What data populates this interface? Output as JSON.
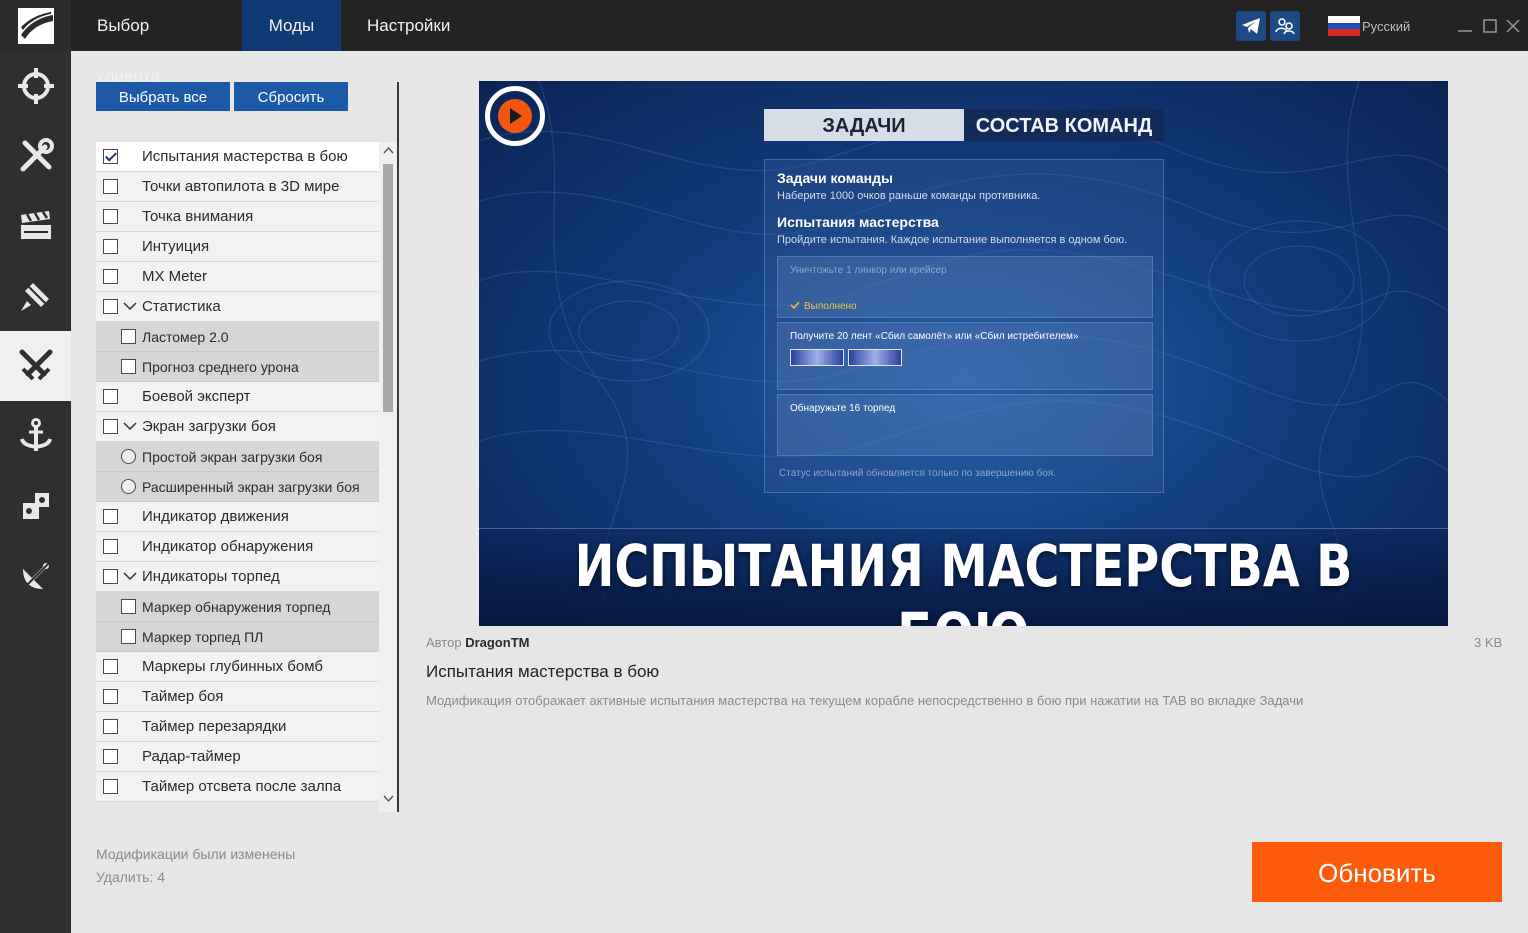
{
  "header": {
    "tabs": [
      {
        "label": "Выбор клиента",
        "active": false
      },
      {
        "label": "Моды",
        "active": true
      },
      {
        "label": "Настройки",
        "active": false
      }
    ],
    "language": "Русский"
  },
  "sidebar": {
    "items": [
      {
        "icon": "crosshair-icon",
        "active": false
      },
      {
        "icon": "wrench-screwdriver-icon",
        "active": false
      },
      {
        "icon": "camera-clapper-icon",
        "active": false
      },
      {
        "icon": "flashlight-icon",
        "active": false
      },
      {
        "icon": "crossed-swords-icon",
        "active": true
      },
      {
        "icon": "anchor-icon",
        "active": false
      },
      {
        "icon": "puzzle-icon",
        "active": false
      },
      {
        "icon": "satellite-dish-icon",
        "active": false
      }
    ]
  },
  "toolbar": {
    "select_all_label": "Выбрать все",
    "reset_label": "Сбросить"
  },
  "mods": [
    {
      "label": "Испытания мастерства в бою",
      "checked": true,
      "selected": true
    },
    {
      "label": "Точки автопилота в 3D мире"
    },
    {
      "label": "Точка внимания"
    },
    {
      "label": "Интуиция"
    },
    {
      "label": "MX Meter"
    },
    {
      "label": "Статистика",
      "group": true
    },
    {
      "label": "Ластомер 2.0",
      "child": true
    },
    {
      "label": "Прогноз среднего урона",
      "child": true
    },
    {
      "label": "Боевой эксперт"
    },
    {
      "label": "Экран загрузки боя",
      "group": true
    },
    {
      "label": "Простой экран загрузки боя",
      "child": true,
      "radio": true
    },
    {
      "label": "Расширенный экран загрузки боя",
      "child": true,
      "radio": true
    },
    {
      "label": "Индикатор движения"
    },
    {
      "label": "Индикатор обнаружения"
    },
    {
      "label": "Индикаторы торпед",
      "group": true
    },
    {
      "label": "Маркер обнаружения торпед",
      "child": true
    },
    {
      "label": "Маркер торпед ПЛ",
      "child": true
    },
    {
      "label": "Маркеры глубинных бомб"
    },
    {
      "label": "Таймер боя"
    },
    {
      "label": "Таймер перезарядки"
    },
    {
      "label": "Радар-таймер"
    },
    {
      "label": "Таймер отсвета после залпа"
    }
  ],
  "status": {
    "changed": "Модификации были изменены",
    "delete": "Удалить: 4"
  },
  "preview": {
    "tab_tasks": "ЗАДАЧИ",
    "tab_teams": "СОСТАВ КОМАНД",
    "team_tasks_title": "Задачи команды",
    "team_tasks_text": "Наберите 1000 очков раньше команды противника.",
    "challenges_title": "Испытания мастерства",
    "challenges_text": "Пройдите испытания. Каждое испытание выполняется в одном бою.",
    "challenge1": "Уничтожьте 1 линкор или крейсер",
    "challenge1_status": "Выполнено",
    "challenge2": "Получите 20 лент «Сбил самолёт» или «Сбил истребителем»",
    "challenge3": "Обнаружьте 16 торпед",
    "note": "Статус испытаний обновляется только по завершению боя.",
    "banner_title": "ИСПЫТАНИЯ МАСТЕРСТВА В БОЮ"
  },
  "details": {
    "author_prefix": "Автор",
    "author_name": "DragonTM",
    "size": "3 KB",
    "title": "Испытания мастерства в бою",
    "description": "Модификация отображает активные испытания мастерства на текущем корабле непосредственно в бою при нажатии на TAB во вкладке Задачи"
  },
  "update_label": "Обновить",
  "colors": {
    "accent": "#fe5a0c",
    "brand_blue": "#1c5aa8",
    "active_tab": "#103a73"
  }
}
